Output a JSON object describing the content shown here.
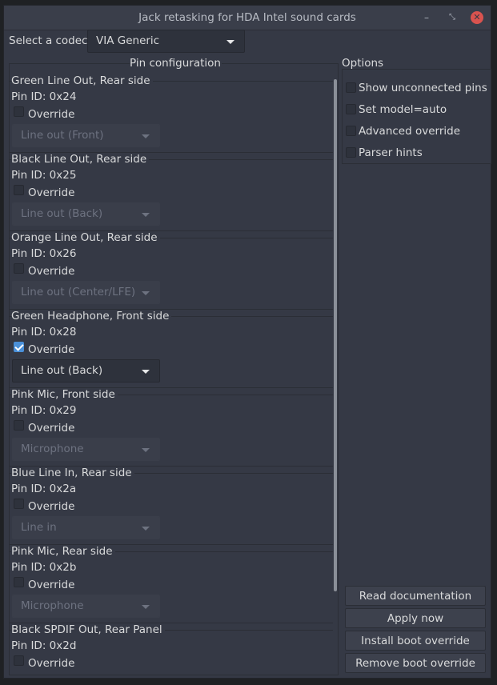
{
  "window": {
    "title": "Jack retasking for HDA Intel sound cards",
    "controls": {
      "minimize": "–",
      "maximize": "⤡",
      "close": "✕"
    }
  },
  "codec": {
    "label": "Select a codec:",
    "selected": "VIA Generic"
  },
  "pins": {
    "heading": "Pin configuration",
    "items": [
      {
        "title": "Green Line Out, Rear side",
        "pin_id": "Pin ID: 0x24",
        "override_label": "Override",
        "override": false,
        "value": "Line out (Front)"
      },
      {
        "title": "Black Line Out, Rear side",
        "pin_id": "Pin ID: 0x25",
        "override_label": "Override",
        "override": false,
        "value": "Line out (Back)"
      },
      {
        "title": "Orange Line Out, Rear side",
        "pin_id": "Pin ID: 0x26",
        "override_label": "Override",
        "override": false,
        "value": "Line out (Center/LFE)"
      },
      {
        "title": "Green Headphone, Front side",
        "pin_id": "Pin ID: 0x28",
        "override_label": "Override",
        "override": true,
        "value": "Line out (Back)"
      },
      {
        "title": "Pink Mic, Front side",
        "pin_id": "Pin ID: 0x29",
        "override_label": "Override",
        "override": false,
        "value": "Microphone"
      },
      {
        "title": "Blue Line In, Rear side",
        "pin_id": "Pin ID: 0x2a",
        "override_label": "Override",
        "override": false,
        "value": "Line in"
      },
      {
        "title": "Pink Mic, Rear side",
        "pin_id": "Pin ID: 0x2b",
        "override_label": "Override",
        "override": false,
        "value": "Microphone"
      },
      {
        "title": "Black SPDIF Out, Rear Panel",
        "pin_id": "Pin ID: 0x2d",
        "override_label": "Override",
        "override": false,
        "value": ""
      }
    ]
  },
  "options": {
    "heading": "Options",
    "items": [
      {
        "label": "Show unconnected pins",
        "checked": false
      },
      {
        "label": "Set model=auto",
        "checked": false
      },
      {
        "label": "Advanced override",
        "checked": false
      },
      {
        "label": "Parser hints",
        "checked": false
      }
    ]
  },
  "actions": {
    "read_docs": "Read documentation",
    "apply": "Apply now",
    "install": "Install boot override",
    "remove": "Remove boot override"
  },
  "colors": {
    "background": "#353945",
    "accent": "#4a90d9",
    "close": "#d9534f"
  }
}
